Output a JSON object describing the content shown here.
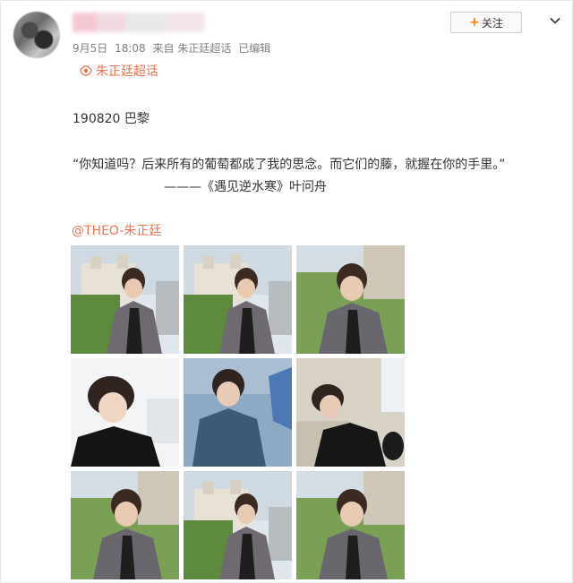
{
  "post": {
    "meta": {
      "date": "9月5日",
      "time": "18:08",
      "source": "来自 朱正廷超话",
      "edited": "已编辑"
    },
    "follow_label": "关注",
    "follow_plus": "+",
    "topic": "朱正廷超话",
    "line1": "190820 巴黎",
    "line2": "“你知道吗？后来所有的葡萄都成了我的思念。而它们的藤，就握在你的手里。”",
    "line3": "———《遇见逆水寒》叶问舟",
    "mention": "@THEO-朱正廷"
  },
  "icons": {
    "more": "chevron-down-icon",
    "topic": "super-topic-icon"
  },
  "colors": {
    "accent": "#eb7350",
    "follow_plus": "#ff8200",
    "meta": "#808080"
  },
  "photos": [
    {
      "scene": "building-sky-trees",
      "label": "photo-1"
    },
    {
      "scene": "building-sky-trees",
      "label": "photo-2"
    },
    {
      "scene": "trees-closeup",
      "label": "photo-3"
    },
    {
      "scene": "bright-white",
      "label": "photo-4"
    },
    {
      "scene": "blue-portrait",
      "label": "photo-5"
    },
    {
      "scene": "stone-wall",
      "label": "photo-6"
    },
    {
      "scene": "trees-closeup",
      "label": "photo-7"
    },
    {
      "scene": "building-sky-trees",
      "label": "photo-8"
    },
    {
      "scene": "trees-closeup",
      "label": "photo-9"
    }
  ]
}
